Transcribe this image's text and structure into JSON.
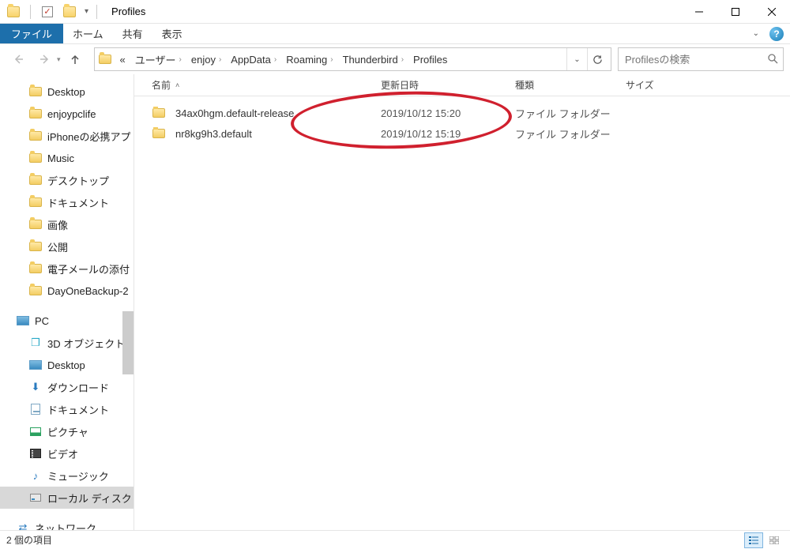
{
  "title": "Profiles",
  "menus": {
    "file": "ファイル",
    "home": "ホーム",
    "share": "共有",
    "view": "表示"
  },
  "breadcrumb": {
    "overflow": "«",
    "items": [
      "ユーザー",
      "enjoy",
      "AppData",
      "Roaming",
      "Thunderbird",
      "Profiles"
    ]
  },
  "search": {
    "placeholder": "Profilesの検索"
  },
  "columns": {
    "name": "名前",
    "date": "更新日時",
    "kind": "種類",
    "size": "サイズ"
  },
  "rows": [
    {
      "name": "34ax0hgm.default-release",
      "date": "2019/10/12 15:20",
      "kind": "ファイル フォルダー",
      "size": ""
    },
    {
      "name": "nr8kg9h3.default",
      "date": "2019/10/12 15:19",
      "kind": "ファイル フォルダー",
      "size": ""
    }
  ],
  "sidebar": {
    "quick": [
      {
        "label": "Desktop",
        "icon": "folder"
      },
      {
        "label": "enjoypclife",
        "icon": "folder"
      },
      {
        "label": "iPhoneの必携アプ",
        "icon": "folder"
      },
      {
        "label": "Music",
        "icon": "folder"
      },
      {
        "label": "デスクトップ",
        "icon": "folder"
      },
      {
        "label": "ドキュメント",
        "icon": "folder"
      },
      {
        "label": "画像",
        "icon": "folder"
      },
      {
        "label": "公開",
        "icon": "folder"
      },
      {
        "label": "電子メールの添付フ",
        "icon": "folder"
      },
      {
        "label": "DayOneBackup-2",
        "icon": "folder"
      }
    ],
    "pc_label": "PC",
    "pc_items": [
      {
        "label": "3D オブジェクト",
        "icon": "cube"
      },
      {
        "label": "Desktop",
        "icon": "monitor"
      },
      {
        "label": "ダウンロード",
        "icon": "download"
      },
      {
        "label": "ドキュメント",
        "icon": "document"
      },
      {
        "label": "ピクチャ",
        "icon": "picture"
      },
      {
        "label": "ビデオ",
        "icon": "video"
      },
      {
        "label": "ミュージック",
        "icon": "music"
      },
      {
        "label": "ローカル ディスク (C",
        "icon": "disk",
        "selected": true
      }
    ],
    "network_label": "ネットワーク"
  },
  "status": {
    "items": "2 個の項目"
  }
}
